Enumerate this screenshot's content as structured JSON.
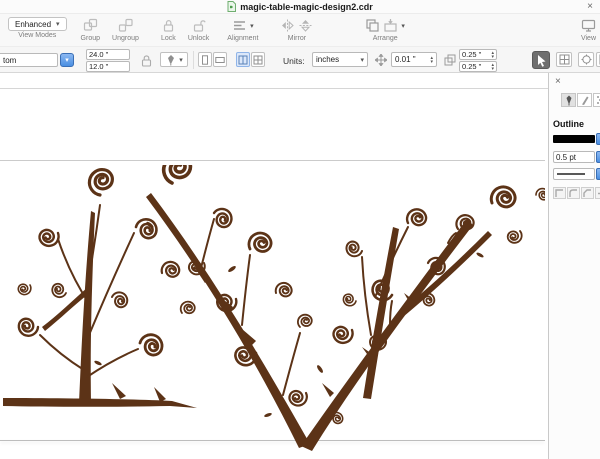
{
  "titlebar": {
    "title": "magic-table-magic-design2.cdr",
    "close_icon": "×"
  },
  "toolbar": {
    "view_modes_value": "Enhanced",
    "labels": {
      "view_modes": "View Modes",
      "group": "Group",
      "ungroup": "Ungroup",
      "lock": "Lock",
      "unlock": "Unlock",
      "alignment": "Alignment",
      "mirror": "Mirror",
      "arrange": "Arrange",
      "view": "View"
    }
  },
  "propertybar": {
    "preset_value": "tom",
    "object_width": "24.0 \"",
    "object_height": "12.0 \"",
    "units_label": "Units:",
    "units_value": "inches",
    "nudge_value": "0.01 \"",
    "duplicate_x": "0.25 \"",
    "duplicate_y": "0.25 \""
  },
  "panel": {
    "close_icon": "×",
    "title": "Outline",
    "outline_width": "0.5 pt"
  },
  "glyphs": {
    "chevron_down": "▾",
    "chevron_up": "▴"
  },
  "colors": {
    "flourish": "#5c3317",
    "accent_blue": "#4a8fe2",
    "swatch": "#000000"
  }
}
